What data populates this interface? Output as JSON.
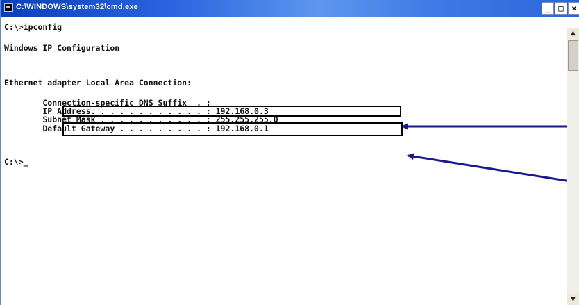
{
  "window": {
    "title": "C:\\WINDOWS\\system32\\cmd.exe",
    "buttons": {
      "minimize": "_",
      "maximize": "□",
      "close": "×"
    }
  },
  "console": {
    "lines": [
      "C:\\>ipconfig",
      "Windows IP Configuration",
      "Ethernet adapter Local Area Connection:",
      "        Connection-specific DNS Suffix  . :",
      "        IP Address. . . . . . . . . . . . : 192.168.0.3",
      "        Subnet Mask . . . . . . . . . . . : 255.255.255.0",
      "        Default Gateway . . . . . . . . . : 192.168.0.1",
      "C:\\>_"
    ]
  },
  "annotations": {
    "arrow_color": "#1a1a8c",
    "box_color": "#000000"
  },
  "scrollbar": {
    "up_glyph": "▲",
    "down_glyph": "▼"
  }
}
